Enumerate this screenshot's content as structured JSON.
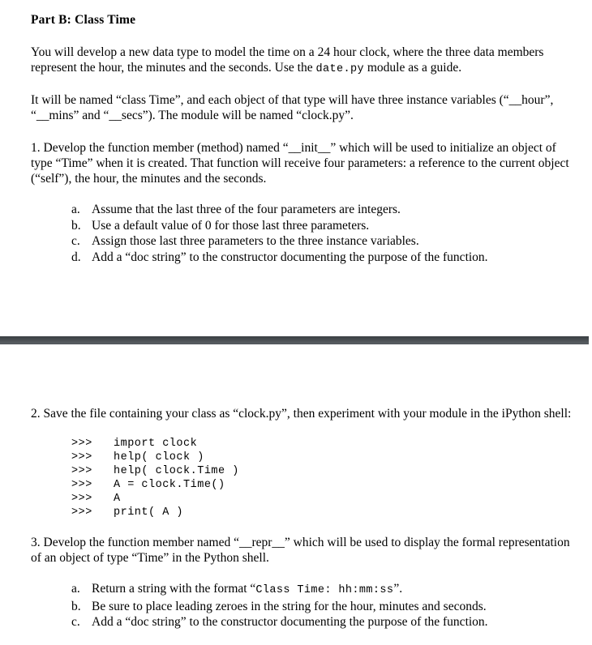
{
  "document": {
    "section_heading": "Part B:  Class Time",
    "page_one": {
      "intro_paragraph": {
        "line1_before_mono": "You will develop a new data type to model the time on a 24 hour clock, where the three data members represent the hour, the minutes and the seconds.  Use the ",
        "mono_module": "date.py",
        "line1_after_mono": " module as a guide."
      },
      "naming_paragraph": "It will be named “class Time”, and each object of that type will have three instance variables (“__hour”, “__mins” and “__secs”).  The module will be named “clock.py”.",
      "item1": "1.  Develop the function member (method) named “__init__” which will be used to initialize an object of type “Time” when it is created.  That function will receive four parameters:  a reference to the current object (“self”), the hour, the minutes and the seconds.",
      "item1_sublist": [
        {
          "marker": "a.",
          "text": "Assume that the last three of the four parameters are integers."
        },
        {
          "marker": "b.",
          "text": "Use a default value of 0 for those last three parameters."
        },
        {
          "marker": "c.",
          "text": "Assign those last three parameters to the three instance variables."
        },
        {
          "marker": "d.",
          "text": "Add a “doc string” to the constructor documenting the purpose of the function."
        }
      ]
    },
    "page_two": {
      "item2": "2.  Save the file containing your class as “clock.py”, then experiment with your module in the iPython shell:",
      "code_transcript": [
        {
          "prompt": ">>>",
          "code": "import clock"
        },
        {
          "prompt": ">>>",
          "code": "help( clock )"
        },
        {
          "prompt": ">>>",
          "code": "help( clock.Time )"
        },
        {
          "prompt": ">>>",
          "code": "A = clock.Time()"
        },
        {
          "prompt": ">>>",
          "code": "A"
        },
        {
          "prompt": ">>>",
          "code": "print( A )"
        }
      ],
      "item3": "3.  Develop the function member named “__repr__” which will be used to display the formal representation of an object of type “Time” in the Python shell.",
      "item3_sublist": [
        {
          "marker": "a.",
          "text_before_mono": "Return a string with the format “",
          "mono": "Class Time:  hh:mm:ss",
          "text_after_mono": "”."
        },
        {
          "marker": "b.",
          "text": "Be sure to place leading zeroes in the string for the hour, minutes and seconds."
        },
        {
          "marker": "c.",
          "text": "Add a “doc string” to the constructor documenting the purpose of the function."
        }
      ]
    }
  },
  "colors": {
    "page_background": "#ffffff",
    "text": "#000000",
    "page_break_band": "#4d5256"
  }
}
